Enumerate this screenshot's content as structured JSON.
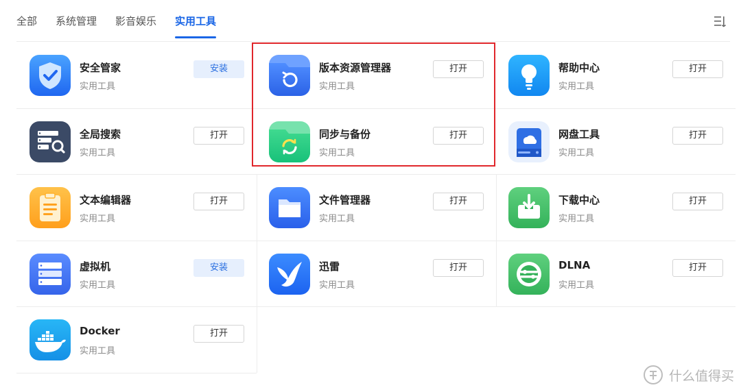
{
  "tabs": [
    {
      "label": "全部",
      "active": false
    },
    {
      "label": "系统管理",
      "active": false
    },
    {
      "label": "影音娱乐",
      "active": false
    },
    {
      "label": "实用工具",
      "active": true
    }
  ],
  "apps": [
    {
      "name": "安全管家",
      "category": "实用工具",
      "action": "安装",
      "icon": "shield-check-icon"
    },
    {
      "name": "版本资源管理器",
      "category": "实用工具",
      "action": "打开",
      "icon": "folder-history-icon"
    },
    {
      "name": "帮助中心",
      "category": "实用工具",
      "action": "打开",
      "icon": "lightbulb-icon"
    },
    {
      "name": "全局搜索",
      "category": "实用工具",
      "action": "打开",
      "icon": "server-search-icon"
    },
    {
      "name": "同步与备份",
      "category": "实用工具",
      "action": "打开",
      "icon": "folder-sync-icon"
    },
    {
      "name": "网盘工具",
      "category": "实用工具",
      "action": "打开",
      "icon": "cloud-drive-icon"
    },
    {
      "name": "文本编辑器",
      "category": "实用工具",
      "action": "打开",
      "icon": "clipboard-icon"
    },
    {
      "name": "文件管理器",
      "category": "实用工具",
      "action": "打开",
      "icon": "folder-icon"
    },
    {
      "name": "下载中心",
      "category": "实用工具",
      "action": "打开",
      "icon": "download-tray-icon"
    },
    {
      "name": "虚拟机",
      "category": "实用工具",
      "action": "安装",
      "icon": "server-stack-icon"
    },
    {
      "name": "迅雷",
      "category": "实用工具",
      "action": "打开",
      "icon": "bird-icon"
    },
    {
      "name": "DLNA",
      "category": "实用工具",
      "action": "打开",
      "icon": "dlna-icon"
    },
    {
      "name": "Docker",
      "category": "实用工具",
      "action": "打开",
      "icon": "docker-whale-icon"
    }
  ],
  "colors": {
    "accent": "#1a66e6",
    "highlight_box": "#e0262b",
    "install_bg": "#e6effd"
  },
  "watermark": {
    "text": "什么值得买"
  }
}
